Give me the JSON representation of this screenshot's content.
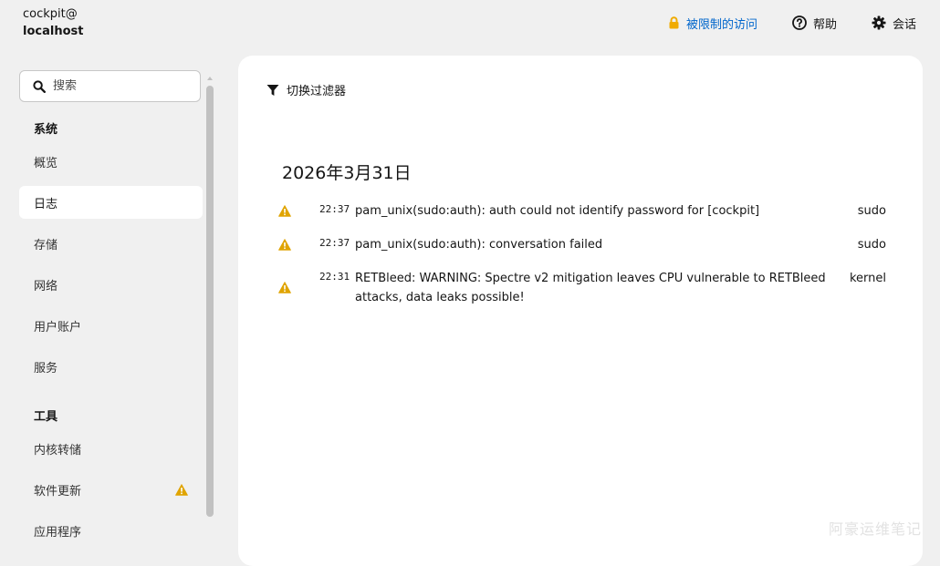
{
  "host": {
    "user": "cockpit@",
    "hostname": "localhost"
  },
  "topbar": {
    "limited_access": "被限制的访问",
    "help": "帮助",
    "session": "会话"
  },
  "sidebar": {
    "search_placeholder": "搜索",
    "sections": [
      {
        "title": "系统",
        "items": [
          {
            "label": "概览"
          },
          {
            "label": "日志"
          },
          {
            "label": "存储"
          },
          {
            "label": "网络"
          },
          {
            "label": "用户账户"
          },
          {
            "label": "服务"
          }
        ]
      },
      {
        "title": "工具",
        "items": [
          {
            "label": "内核转储"
          },
          {
            "label": "软件更新"
          },
          {
            "label": "应用程序"
          }
        ]
      }
    ],
    "active_item": "日志"
  },
  "main": {
    "filter_toggle": "切换过滤器",
    "date": "2026年3月31日",
    "entries": [
      {
        "time": "22:37",
        "message": "pam_unix(sudo:auth): auth could not identify password for [cockpit]",
        "identifier": "sudo",
        "priority_icon": "warning-icon"
      },
      {
        "time": "22:37",
        "message": "pam_unix(sudo:auth): conversation failed",
        "identifier": "sudo",
        "priority_icon": "warning-icon"
      },
      {
        "time": "22:31",
        "message": "RETBleed: WARNING: Spectre v2 mitigation leaves CPU vulnerable to RETBleed attacks, data leaks possible!",
        "identifier": "kernel",
        "priority_icon": "warning-icon"
      }
    ]
  },
  "watermark": "阿豪运维笔记",
  "colors": {
    "background": "#f0f0f0",
    "card": "#ffffff",
    "link": "#0066cc",
    "lock": "#f0ab00",
    "warning": "#e0a400"
  }
}
